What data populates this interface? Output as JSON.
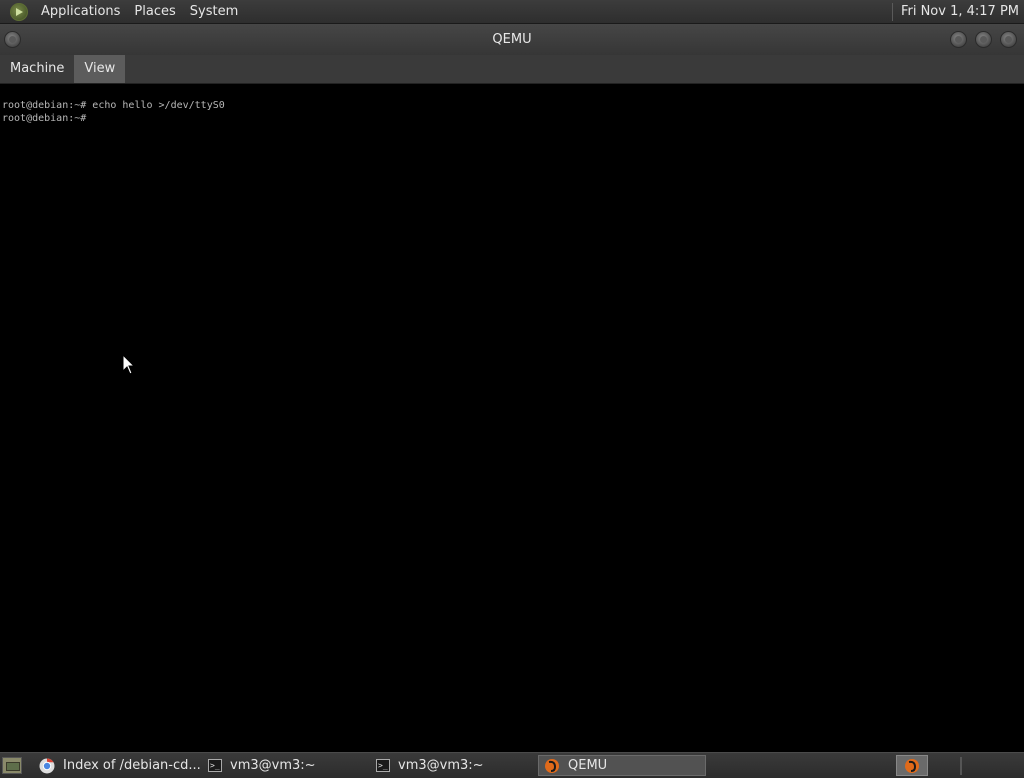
{
  "top_panel": {
    "menus": [
      "Applications",
      "Places",
      "System"
    ],
    "clock": "Fri Nov  1,  4:17 PM"
  },
  "window": {
    "title": "QEMU",
    "menubar": [
      "Machine",
      "View"
    ],
    "active_menu": "View"
  },
  "console": {
    "lines": [
      "root@debian:~# echo hello >/dev/ttyS0",
      "root@debian:~#"
    ]
  },
  "taskbar": {
    "tasks": [
      {
        "label": "Index of /debian-cd...",
        "icon": "chrome-icon",
        "active": false
      },
      {
        "label": "vm3@vm3:~",
        "icon": "terminal-icon",
        "active": false
      },
      {
        "label": "vm3@vm3:~",
        "icon": "terminal-icon",
        "active": false
      },
      {
        "label": "QEMU",
        "icon": "qemu-icon",
        "active": true
      }
    ]
  },
  "colors": {
    "panel_bg": "#333333",
    "console_bg": "#000000",
    "console_text": "#b8b8b8",
    "active_item": "#5c5c5c",
    "qemu_orange": "#e06a1a"
  }
}
